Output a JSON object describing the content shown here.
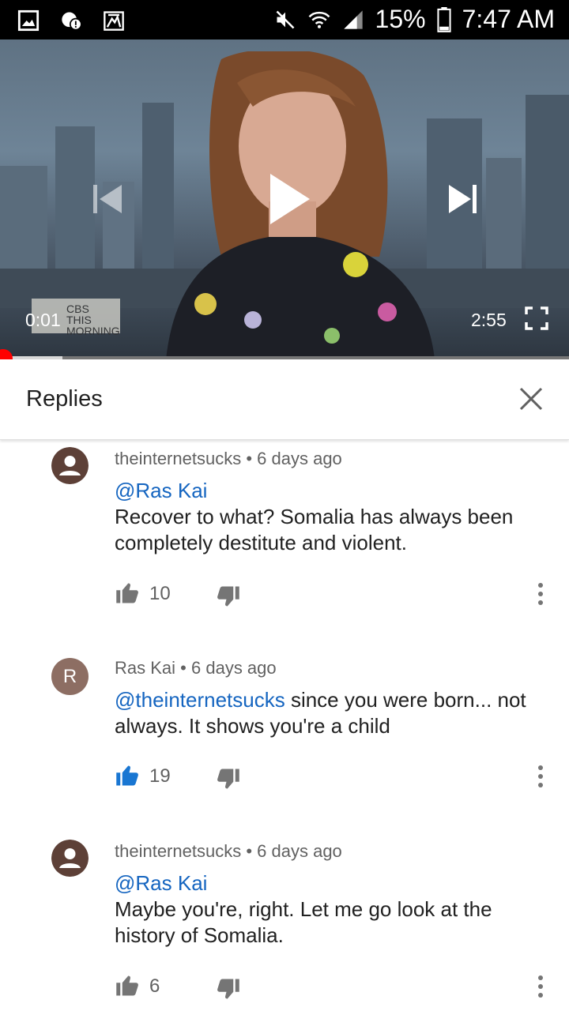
{
  "status_bar": {
    "battery": "15%",
    "time": "7:47 AM",
    "left_icons": [
      "gallery-icon",
      "messenger-alert-icon",
      "tool-icon"
    ],
    "right_icons": [
      "mute-icon",
      "wifi-icon",
      "signal-icon",
      "battery-icon"
    ]
  },
  "player": {
    "current_time": "0:01",
    "duration": "2:55",
    "watermark": "CBS THIS MORNING",
    "progress_fraction": 0.006,
    "buffer_fraction": 0.11
  },
  "replies_panel": {
    "title": "Replies"
  },
  "comments": [
    {
      "author": "theinternetsucks",
      "time": "6 days ago",
      "mention": "@Ras Kai",
      "text": "Recover to what?  Somalia has always been completely destitute and violent.",
      "likes": "10",
      "liked": false,
      "avatar": "default-user-icon"
    },
    {
      "author": "Ras Kai",
      "time": "6 days ago",
      "mention": "@theinternetsucks",
      "text": " since you were born... not always. It shows you're a child",
      "likes": "19",
      "liked": true,
      "avatar_letter": "R"
    },
    {
      "author": "theinternetsucks",
      "time": "6 days ago",
      "mention": "@Ras Kai",
      "text": "Maybe you're, right.  Let me go look at the history of Somalia.",
      "likes": "6",
      "liked": false,
      "avatar": "default-user-icon"
    }
  ],
  "colors": {
    "mention": "#1565c0",
    "liked": "#1976d2",
    "icon_gray": "#757575",
    "scrubber": "#ff0000"
  }
}
